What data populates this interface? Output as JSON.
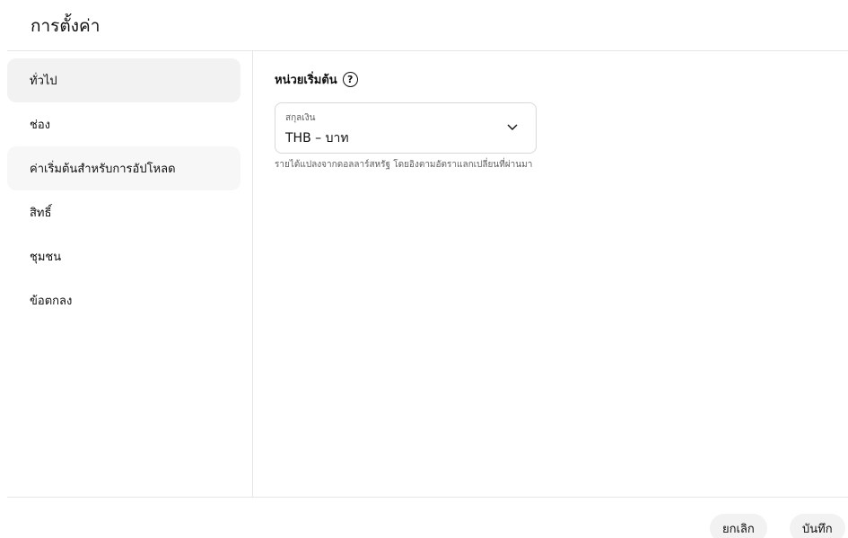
{
  "dialog": {
    "title": "การตั้งค่า"
  },
  "sidebar": {
    "items": [
      {
        "label": "ทั่วไป",
        "state": "active"
      },
      {
        "label": "ช่อง",
        "state": "normal"
      },
      {
        "label": "ค่าเริ่มต้นสำหรับการอัปโหลด",
        "state": "hover"
      },
      {
        "label": "สิทธิ์",
        "state": "normal"
      },
      {
        "label": "ชุมชน",
        "state": "normal"
      },
      {
        "label": "ข้อตกลง",
        "state": "normal"
      }
    ]
  },
  "main": {
    "section_title": "หน่วยเริ่มต้น",
    "help_icon": "?",
    "currency": {
      "label": "สกุลเงิน",
      "value": "THB – บาท",
      "icon": "chevron-down-icon"
    },
    "helper_text": "รายได้แปลงจากดอลลาร์สหรัฐ โดยอิงตามอัตราแลกเปลี่ยนที่ผ่านมา"
  },
  "footer": {
    "cancel_label": "ยกเลิก",
    "save_label": "บันทึก"
  },
  "colors": {
    "background": "#ffffff",
    "active_nav": "#f2f2f2",
    "divider": "#e5e5e5",
    "secondary_text": "#606060"
  }
}
